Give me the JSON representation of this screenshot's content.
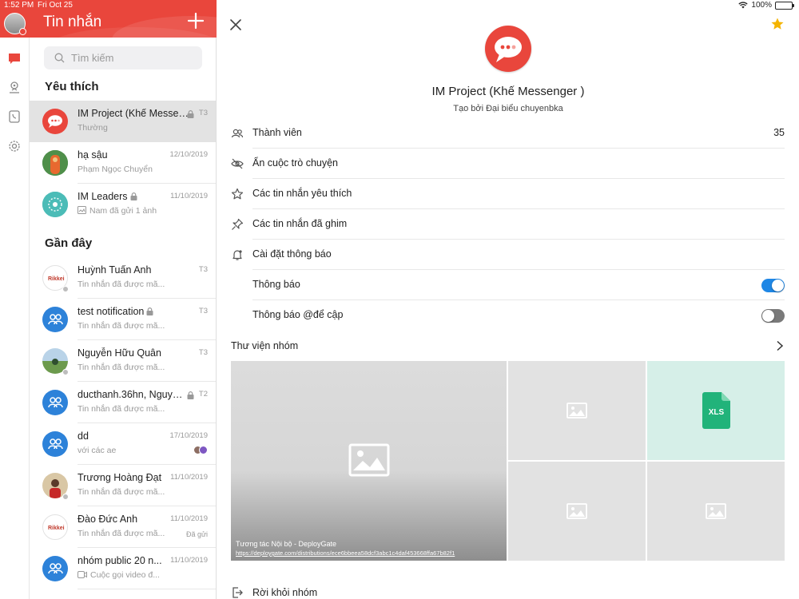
{
  "status_bar": {
    "time": "1:52 PM",
    "date": "Fri Oct 25",
    "battery": "100%"
  },
  "sidebar": {
    "title": "Tin nhắn",
    "search_placeholder": "Tìm kiếm",
    "rail_icons": [
      "chat-icon",
      "contacts-map-icon",
      "phonebook-icon",
      "settings-icon"
    ],
    "favorites_title": "Yêu thích",
    "favorites": [
      {
        "name": "IM Project (Khế Messenger )",
        "sub": "Thường",
        "time": "T3",
        "locked": true,
        "selected": true,
        "avatar": "red-logo"
      },
      {
        "name": "hạ sậu",
        "sub": "Phạm Ngọc Chuyển",
        "time": "12/10/2019",
        "avatar": "photo"
      },
      {
        "name": "IM Leaders",
        "sub": "Nam đã gửi 1 ảnh",
        "time": "11/10/2019",
        "locked": true,
        "avatar": "teal-logo"
      }
    ],
    "recent_title": "Gần đây",
    "recent": [
      {
        "name": "Huỳnh Tuấn Anh",
        "sub": "Tin nhắn đã được mã...",
        "time": "T3",
        "avatar": "rikkei"
      },
      {
        "name": "test notification",
        "sub": "Tin nhắn đã được mã...",
        "time": "T3",
        "locked": true,
        "avatar": "group"
      },
      {
        "name": "Nguyễn Hữu Quân",
        "sub": "Tin nhắn đã được mã...",
        "time": "T3",
        "avatar": "photo-green"
      },
      {
        "name": "ducthanh.36hn, Nguyễn...",
        "sub": "Tin nhắn đã được mã...",
        "time": "T2",
        "locked": true,
        "avatar": "group"
      },
      {
        "name": "dd",
        "sub": "với các ae",
        "time": "17/10/2019",
        "avatar": "group"
      },
      {
        "name": "Trương Hoàng Đạt",
        "sub": "Tin nhắn đã được mã...",
        "time": "11/10/2019",
        "avatar": "photo-red"
      },
      {
        "name": "Đào Đức Anh",
        "sub": "Tin nhắn đã được mã...",
        "time": "11/10/2019",
        "status": "Đã gửi",
        "avatar": "rikkei"
      },
      {
        "name": "nhóm public 20 n...",
        "sub": "Cuộc gọi video đ...",
        "time": "11/10/2019",
        "avatar": "group"
      }
    ]
  },
  "detail": {
    "group_name": "IM Project (Khế Messenger )",
    "creator": "Tạo bởi Đại biểu chuyenbka",
    "members_label": "Thành viên",
    "members_count": "35",
    "hide_label": "Ẩn cuộc trò chuyện",
    "favorite_msgs_label": "Các tin nhắn yêu thích",
    "pinned_msgs_label": "Các tin nhắn đã ghim",
    "notif_settings_label": "Cài đặt thông báo",
    "notif_label": "Thông báo",
    "notif_on": true,
    "mention_label": "Thông báo @để cập",
    "mention_on": false,
    "library_label": "Thư viện nhóm",
    "gallery_caption": "Tương tác Nội bộ - DeployGate",
    "gallery_link": "https://deploygate.com/distributions/ece6bbeea58dcf3abc1c4daf453668ffa67b82f1",
    "xls_label": "XLS",
    "leave_label": "Rời khỏi nhóm"
  },
  "colors": {
    "brand_red": "#e9463c",
    "toggle_blue": "#1f87e5",
    "group_blue": "#2d82d9",
    "xls_green": "#21b37a"
  }
}
